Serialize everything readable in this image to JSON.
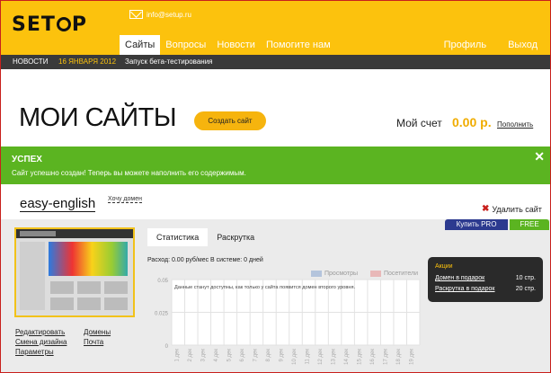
{
  "logo": "SETUP",
  "header": {
    "email": "info@setup.ru",
    "nav": [
      "Сайты",
      "Вопросы",
      "Новости",
      "Помогите нам"
    ],
    "right_nav": [
      "Профиль",
      "Выход"
    ]
  },
  "newsbar": {
    "label": "НОВОСТИ",
    "date": "16 ЯНВАРЯ 2012",
    "text": "Запуск бета-тестирования"
  },
  "page": {
    "title": "МОИ САЙТЫ",
    "create_button": "Создать сайт",
    "account_label": "Мой счет",
    "balance": "0.00 р.",
    "topup": "Пополнить"
  },
  "notice": {
    "heading": "УСПЕХ",
    "message": "Сайт успешно создан! Теперь вы можете наполнить его содержимым.",
    "close": "✕"
  },
  "site": {
    "name": "easy-english",
    "want_domain": "Хочу домен",
    "delete": "Удалить сайт",
    "buy_pro": "Купить PRO",
    "free": "FREE"
  },
  "actions": [
    {
      "label": "Редактировать"
    },
    {
      "label": "Домены"
    },
    {
      "label": "Смена дизайна"
    },
    {
      "label": "Почта"
    },
    {
      "label": "Параметры"
    }
  ],
  "tabs": [
    "Статистика",
    "Раскрутка"
  ],
  "stats": {
    "expense": "Расход: 0.00 руб/мес В системе: 0 дней"
  },
  "promo": {
    "heading": "Акции",
    "rows": [
      {
        "label": "Домен в подарок",
        "value": "10 стр."
      },
      {
        "label": "Раскрутка в подарок",
        "value": "20 стр."
      }
    ]
  },
  "colors": {
    "brand": "#fcc20d",
    "success": "#5bb421",
    "pro": "#2c3a8f"
  },
  "chart_data": {
    "type": "line",
    "y_ticks": [
      "0.05",
      "0.025",
      "0"
    ],
    "ylim": [
      0,
      0.05
    ],
    "x_labels": [
      "1 дек",
      "2 дек",
      "3 дек",
      "4 дек",
      "5 дек",
      "6 дек",
      "7 дек",
      "8 дек",
      "9 дек",
      "10 дек",
      "11 дек",
      "12 дек",
      "13 дек",
      "14 дек",
      "15 дек",
      "16 дек",
      "17 дек",
      "18 дек",
      "19 дек"
    ],
    "series": [
      {
        "name": "Просмотры",
        "color": "#b4c4dc",
        "values": []
      },
      {
        "name": "Посетители",
        "color": "#e8b8b8",
        "values": []
      }
    ],
    "notice": "Данные станут доступны, как только у сайта появится домен второго уровня."
  }
}
